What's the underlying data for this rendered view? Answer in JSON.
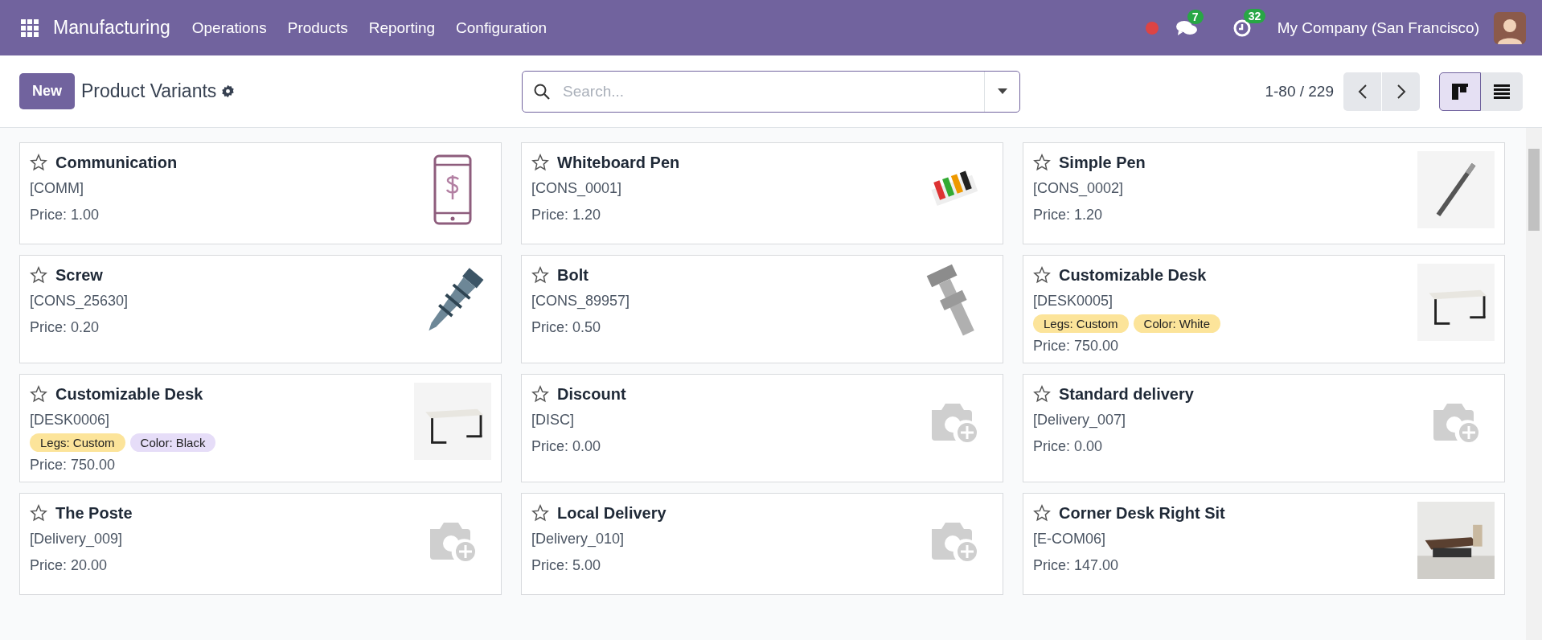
{
  "navbar": {
    "app_name": "Manufacturing",
    "menus": [
      "Operations",
      "Products",
      "Reporting",
      "Configuration"
    ],
    "messages_count": "7",
    "activities_count": "32",
    "company": "My Company (San Francisco)"
  },
  "control_panel": {
    "new_button": "New",
    "title": "Product Variants",
    "search": {
      "placeholder": "Search..."
    },
    "pager": "1-80 / 229",
    "views": [
      {
        "kind": "kanban",
        "selected": true
      },
      {
        "kind": "list",
        "selected": false
      }
    ]
  },
  "cards": [
    {
      "name": "Communication",
      "code": "[COMM]",
      "price": "Price: 1.00",
      "favorite": false,
      "kind": "icon"
    },
    {
      "name": "Whiteboard Pen",
      "code": "[CONS_0001]",
      "price": "Price: 1.20",
      "favorite": false,
      "kind": "picture"
    },
    {
      "name": "Simple Pen",
      "code": "[CONS_0002]",
      "price": "Price: 1.20",
      "favorite": false,
      "kind": "picture"
    },
    {
      "name": "Screw",
      "code": "[CONS_25630]",
      "price": "Price: 0.20",
      "favorite": false,
      "kind": "picture"
    },
    {
      "name": "Bolt",
      "code": "[CONS_89957]",
      "price": "Price: 0.50",
      "favorite": false,
      "kind": "picture"
    },
    {
      "name": "Customizable Desk",
      "code": "[DESK0005]",
      "price": "Price: 750.00",
      "favorite": false,
      "kind": "picture",
      "tags": [
        {
          "label": "Legs: Custom",
          "color": "#fce49a"
        },
        {
          "label": "Color: White",
          "color": "#fce49a"
        }
      ]
    },
    {
      "name": "Customizable Desk",
      "code": "[DESK0006]",
      "price": "Price: 750.00",
      "favorite": false,
      "kind": "picture",
      "tags": [
        {
          "label": "Legs: Custom",
          "color": "#fce49a"
        },
        {
          "label": "Color: Black",
          "color": "#e6ddf8"
        }
      ]
    },
    {
      "name": "Discount",
      "code": "[DISC]",
      "price": "Price: 0.00",
      "favorite": false,
      "kind": "placeholder"
    },
    {
      "name": "Standard delivery",
      "code": "[Delivery_007]",
      "price": "Price: 0.00",
      "favorite": false,
      "kind": "placeholder"
    },
    {
      "name": "The Poste",
      "code": "[Delivery_009]",
      "price": "Price: 20.00",
      "favorite": false,
      "kind": "placeholder"
    },
    {
      "name": "Local Delivery",
      "code": "[Delivery_010]",
      "price": "Price: 5.00",
      "favorite": false,
      "kind": "placeholder"
    },
    {
      "name": "Corner Desk Right Sit",
      "code": "[E-COM06]",
      "price": "Price: 147.00",
      "favorite": false,
      "kind": "picture"
    }
  ]
}
